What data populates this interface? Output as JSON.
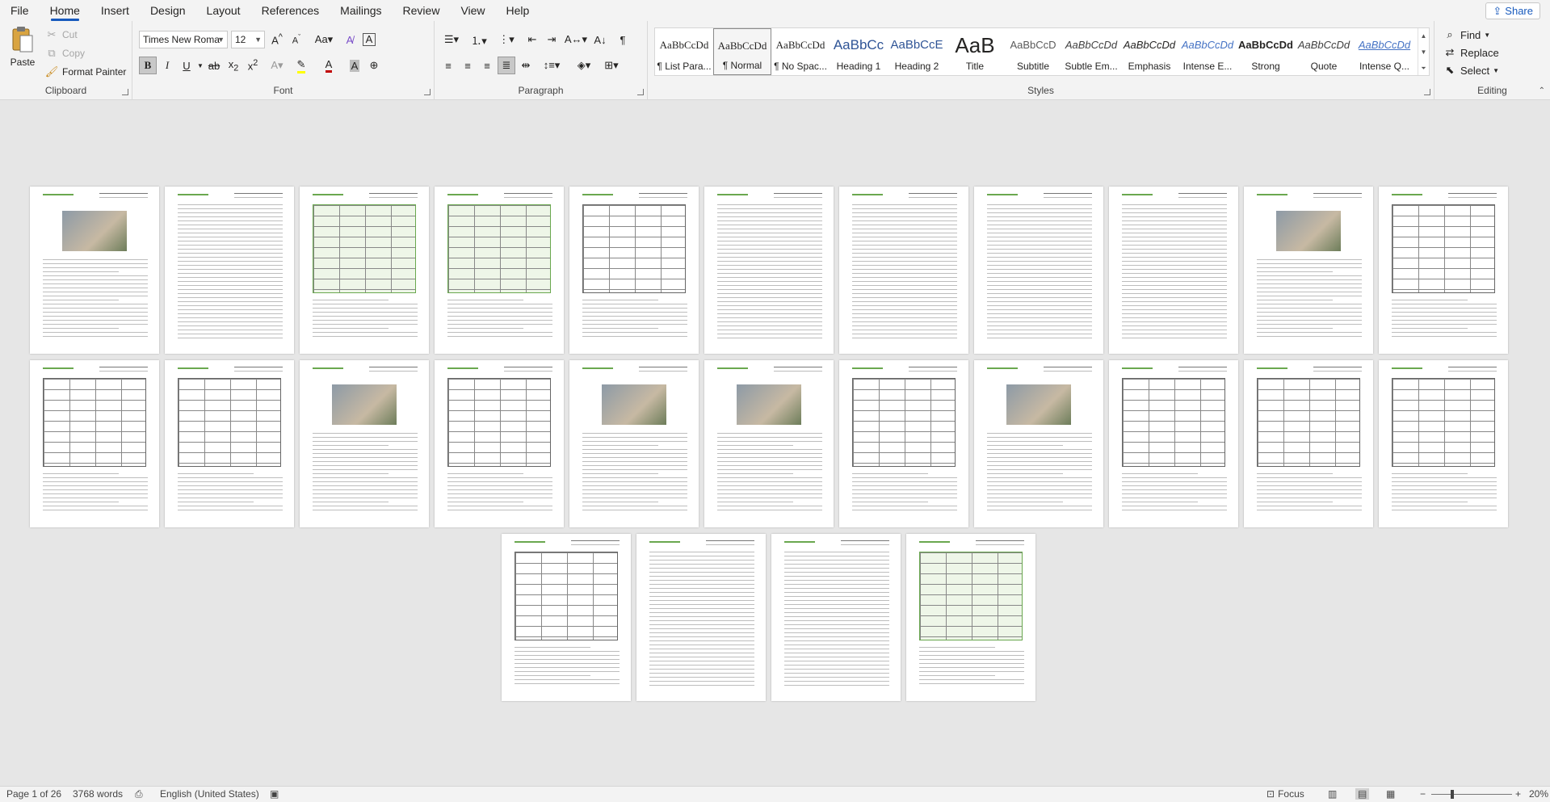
{
  "menu": {
    "items": [
      "File",
      "Home",
      "Insert",
      "Design",
      "Layout",
      "References",
      "Mailings",
      "Review",
      "View",
      "Help"
    ],
    "active": "Home",
    "share_label": "Share"
  },
  "clipboard": {
    "paste_label": "Paste",
    "cut_label": "Cut",
    "copy_label": "Copy",
    "format_painter_label": "Format Painter",
    "group_label": "Clipboard"
  },
  "font": {
    "font_name": "Times New Roma",
    "font_size": "12",
    "group_label": "Font",
    "font_color": "#c00000",
    "highlight_color": "#ffff00"
  },
  "paragraph": {
    "group_label": "Paragraph"
  },
  "styles": {
    "group_label": "Styles",
    "tiles": [
      {
        "preview": "AaBbCcDd",
        "name": "¶ List Para..."
      },
      {
        "preview": "AaBbCcDd",
        "name": "¶ Normal"
      },
      {
        "preview": "AaBbCcDd",
        "name": "¶ No Spac..."
      },
      {
        "preview": "AaBbCc",
        "name": "Heading 1"
      },
      {
        "preview": "AaBbCcE",
        "name": "Heading 2"
      },
      {
        "preview": "AaB",
        "name": "Title"
      },
      {
        "preview": "AaBbCcD",
        "name": "Subtitle"
      },
      {
        "preview": "AaBbCcDd",
        "name": "Subtle Em..."
      },
      {
        "preview": "AaBbCcDd",
        "name": "Emphasis"
      },
      {
        "preview": "AaBbCcDd",
        "name": "Intense E..."
      },
      {
        "preview": "AaBbCcDd",
        "name": "Strong"
      },
      {
        "preview": "AaBbCcDd",
        "name": "Quote"
      },
      {
        "preview": "AaBbCcDd",
        "name": "Intense Q..."
      }
    ],
    "selected": "¶ Normal"
  },
  "editing": {
    "group_label": "Editing",
    "find_label": "Find",
    "replace_label": "Replace",
    "select_label": "Select"
  },
  "status": {
    "page_info": "Page 1 of 26",
    "word_count": "3768 words",
    "language": "English (United States)",
    "focus_label": "Focus",
    "zoom": "20%"
  },
  "document": {
    "page_count_visible": 26,
    "accent_color": "#6aa84f"
  }
}
